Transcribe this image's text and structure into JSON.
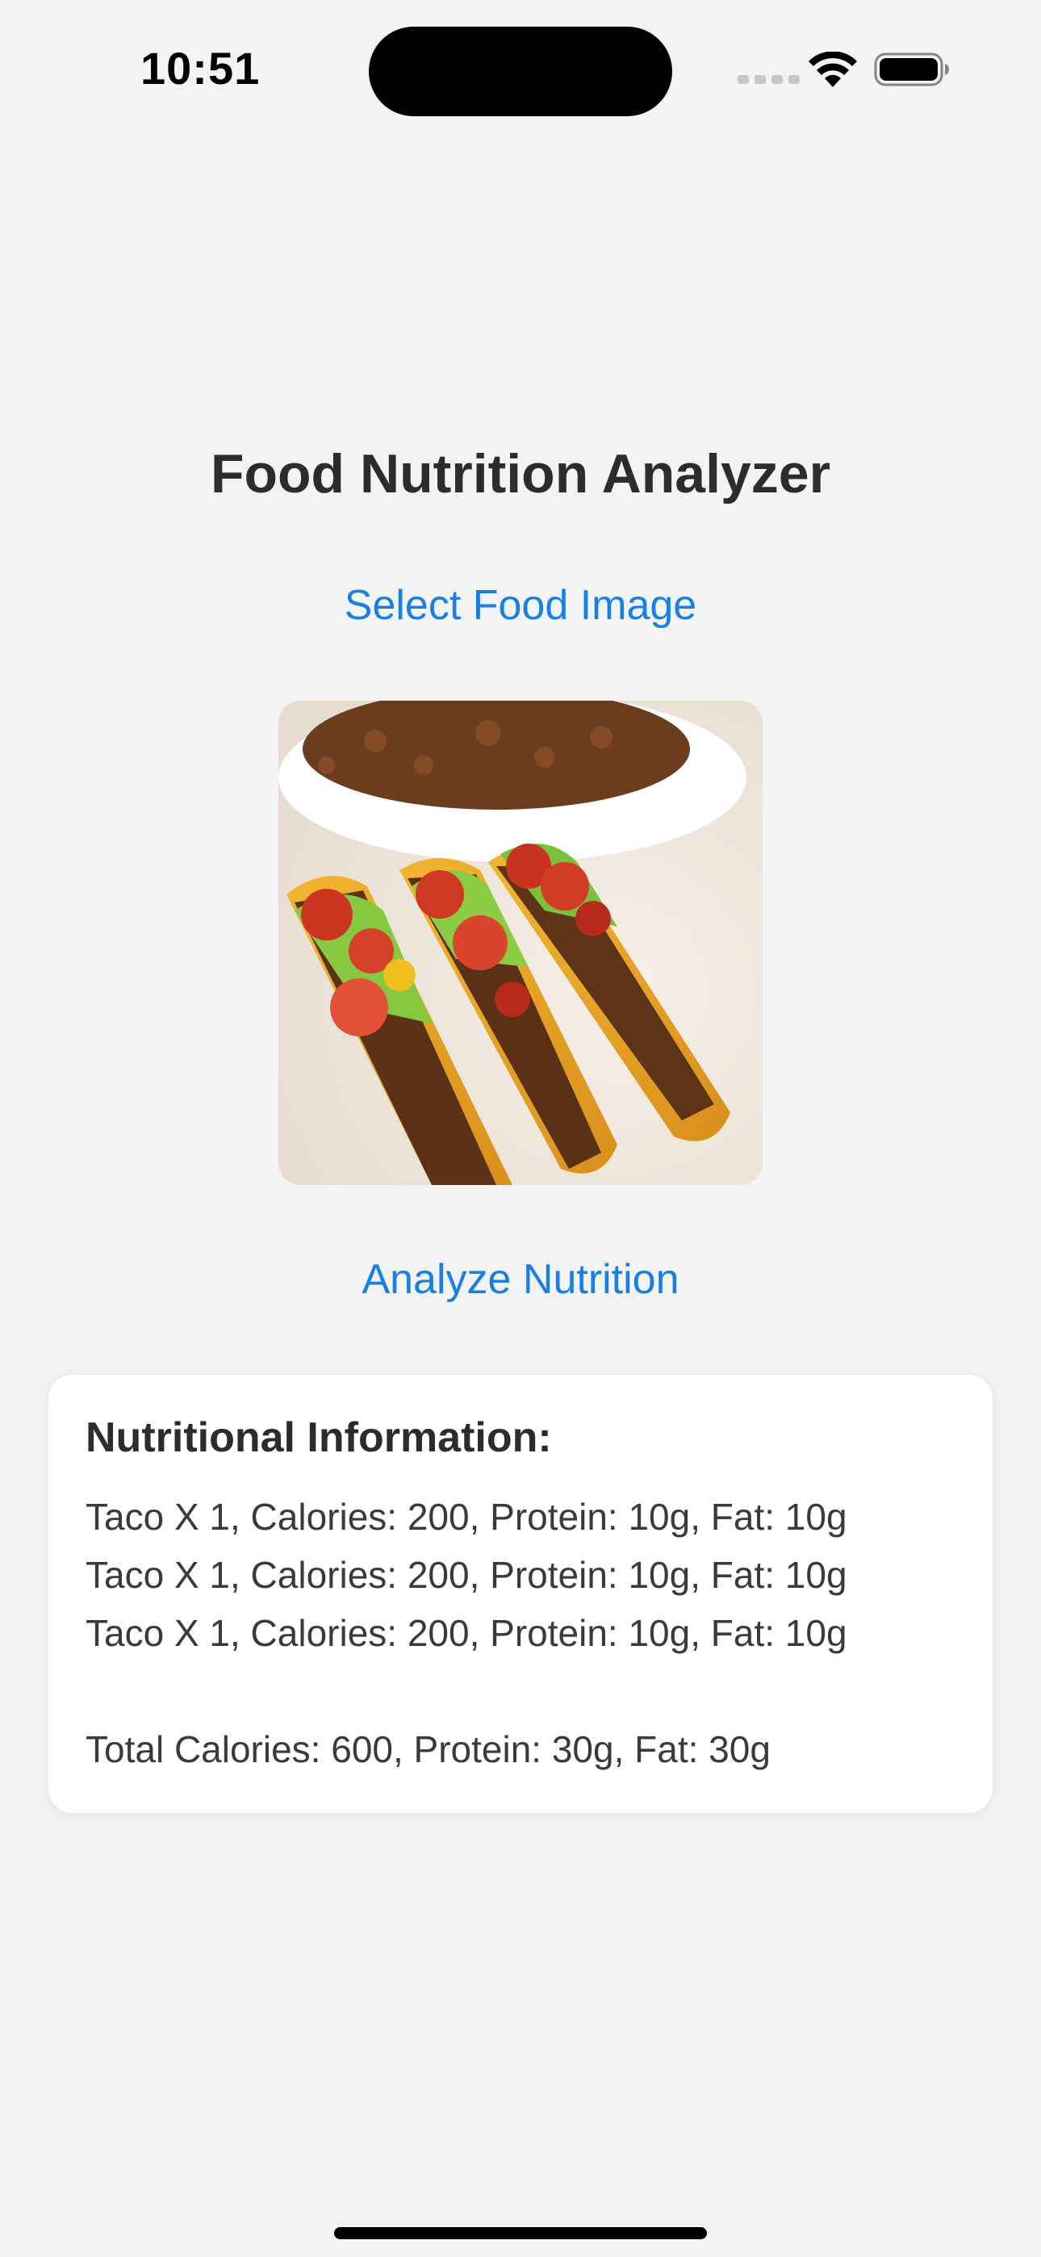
{
  "status_bar": {
    "time": "10:51",
    "icons": [
      "cellular-signal-icon",
      "wifi-icon",
      "battery-icon"
    ]
  },
  "page": {
    "title": "Food Nutrition Analyzer",
    "select_image_label": "Select Food Image",
    "analyze_label": "Analyze Nutrition",
    "accent_color": "#1a7fe3"
  },
  "nutrition": {
    "heading": "Nutritional Information:",
    "items": [
      "Taco X 1, Calories: 200, Protein: 10g, Fat: 10g",
      "Taco X 1, Calories: 200, Protein: 10g, Fat: 10g",
      "Taco X 1, Calories: 200, Protein: 10g, Fat: 10g"
    ],
    "total": "Total Calories: 600, Protein: 30g, Fat: 30g"
  }
}
